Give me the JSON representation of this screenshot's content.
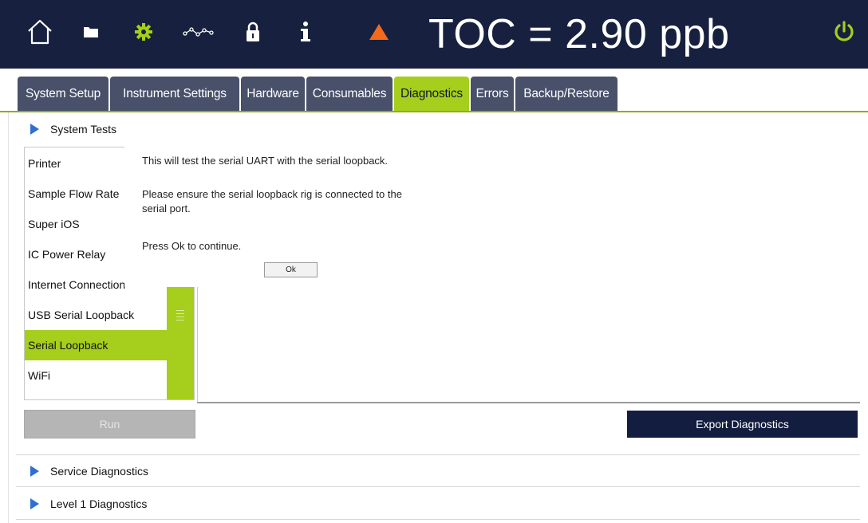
{
  "header": {
    "toc_readout": "TOC = 2.90 ppb",
    "icons": [
      "home-icon",
      "folder-icon",
      "gear-icon",
      "trend-icon",
      "lock-icon",
      "info-icon",
      "warning-icon",
      "power-icon"
    ],
    "colors": {
      "background": "#17213f",
      "gear": "#a6ce1c",
      "warning": "#f26a1c",
      "power": "#a6ce1c"
    }
  },
  "tabs": [
    {
      "label": "System Setup"
    },
    {
      "label": "Instrument Settings"
    },
    {
      "label": "Hardware"
    },
    {
      "label": "Consumables"
    },
    {
      "label": "Diagnostics",
      "active": true
    },
    {
      "label": "Errors"
    },
    {
      "label": "Backup/Restore"
    }
  ],
  "sections": {
    "system_tests": "System Tests",
    "service_diagnostics": "Service Diagnostics",
    "level1_diagnostics": "Level 1 Diagnostics"
  },
  "test_list": {
    "items": [
      {
        "label": "Printer"
      },
      {
        "label": "Sample Flow Rate"
      },
      {
        "label": "Super iOS"
      },
      {
        "label": "IC Power Relay"
      },
      {
        "label": "Internet Connection"
      },
      {
        "label": "USB Serial Loopback"
      },
      {
        "label": "Serial Loopback",
        "selected": true
      },
      {
        "label": "WiFi"
      }
    ]
  },
  "dialog": {
    "line1": "This will test the serial UART with the serial loopback.",
    "line2": "Please ensure the serial loopback rig is connected to the",
    "line3": "serial port.",
    "line4": "Press Ok to continue.",
    "ok_label": "Ok"
  },
  "buttons": {
    "run_label": "Run",
    "export_label": "Export Diagnostics"
  },
  "accent_color": "#a6ce1c",
  "nav_color": "#131d3f"
}
